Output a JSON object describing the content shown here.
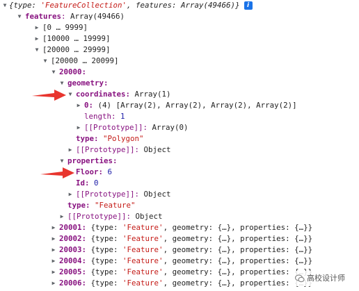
{
  "summary": {
    "pre": "{type: ",
    "type_val": "'FeatureCollection'",
    "mid": ", features: ",
    "arr": "Array(49466)",
    "post": "}"
  },
  "info_icon": "i",
  "features": {
    "key": "features",
    "val": "Array(49466)"
  },
  "ranges": [
    "[0 … 9999]",
    "[10000 … 19999]",
    "[20000 … 29999]",
    "[20000 … 20099]"
  ],
  "item": {
    "index": "20000:",
    "geometry": "geometry:",
    "coordinates": {
      "key": "coordinates:",
      "val": "Array(1)"
    },
    "zero": {
      "key": "0:",
      "count": "(4)",
      "val": "[Array(2), Array(2), Array(2), Array(2)]"
    },
    "length": {
      "key": "length:",
      "val": "1"
    },
    "proto_array": {
      "key": "[[Prototype]]:",
      "val": "Array(0)"
    },
    "type": {
      "key": "type:",
      "val": "\"Polygon\""
    },
    "proto_obj1": {
      "key": "[[Prototype]]:",
      "val": "Object"
    },
    "properties": "properties:",
    "floor": {
      "key": "Floor:",
      "val": "6"
    },
    "id": {
      "key": "Id:",
      "val": "0"
    },
    "proto_obj2": {
      "key": "[[Prototype]]:",
      "val": "Object"
    },
    "ftype": {
      "key": "type:",
      "val": "\"Feature\""
    },
    "proto_obj3": {
      "key": "[[Prototype]]:",
      "val": "Object"
    }
  },
  "collapsed_rows": [
    {
      "key": "20001:"
    },
    {
      "key": "20002:"
    },
    {
      "key": "20003:"
    },
    {
      "key": "20004:"
    },
    {
      "key": "20005:"
    },
    {
      "key": "20006:"
    }
  ],
  "collapsed_parts": {
    "pre": "{type: ",
    "type_val": "'Feature'",
    "rest": ", geometry: {…}, properties: {…}}"
  },
  "watermark": "高校设计师",
  "colors": {
    "key": "#881280",
    "string": "#c41a16",
    "number": "#1a1aa6",
    "arrow": "#e8352e",
    "info": "#1a73e8"
  },
  "icons": {
    "expanded": "triangle-down",
    "collapsed": "triangle-right"
  }
}
